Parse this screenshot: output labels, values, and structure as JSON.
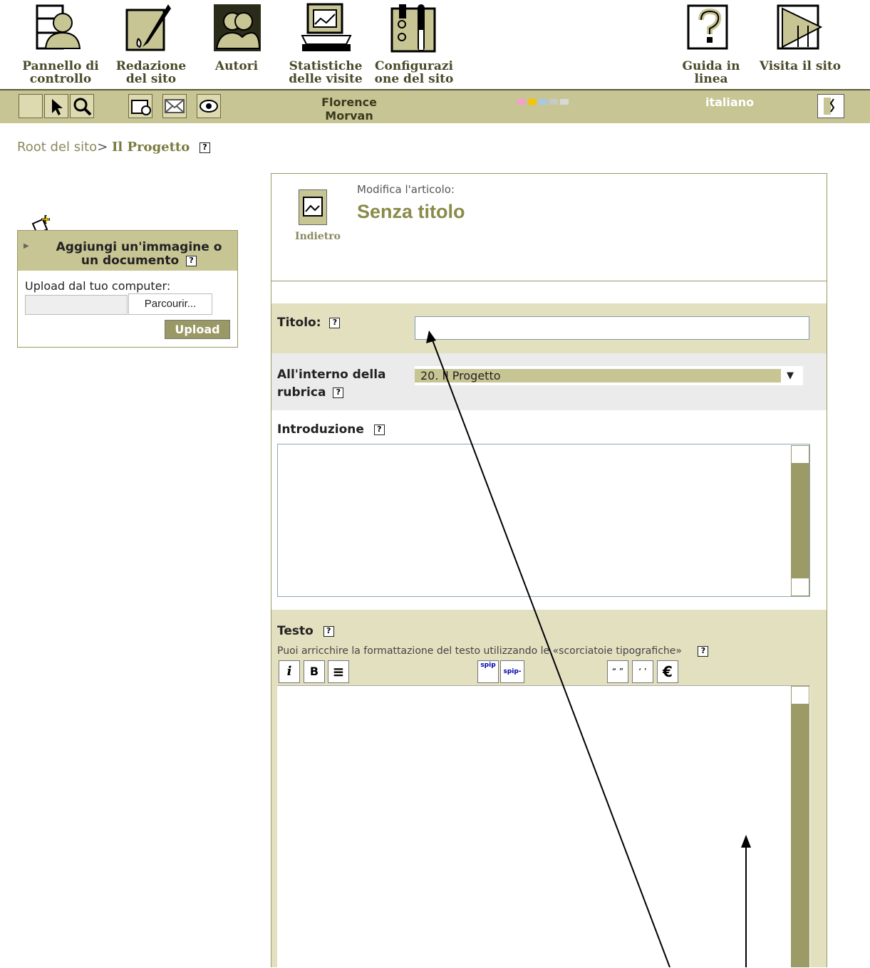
{
  "nav": {
    "items": [
      {
        "label": "Pannello di controllo",
        "icon": "dashboard-icon"
      },
      {
        "label": "Redazione del sito",
        "icon": "pen-icon"
      },
      {
        "label": "Autori",
        "icon": "authors-icon"
      },
      {
        "label": "Statistiche delle visite",
        "icon": "statistics-icon"
      },
      {
        "label": "Configurazi one del sito",
        "icon": "configuration-icon"
      },
      {
        "label": "Guida in linea",
        "icon": "help-icon"
      },
      {
        "label": "Visita il sito",
        "icon": "visit-site-icon"
      }
    ]
  },
  "toolbar": {
    "user_name": "Florence Morvan",
    "language": "italiano",
    "color_swatches": [
      "#f4a0c8",
      "#f6c400",
      "#a8c8e8",
      "#c8c8c8",
      "#d8d8d8"
    ]
  },
  "breadcrumb": {
    "root": "Root del sito",
    "separator": ">",
    "current": "Il Progetto"
  },
  "upload_box": {
    "title": "Aggiungi un'immagine o un documento",
    "prompt": "Upload dal tuo computer:",
    "browse_label": "Parcourir...",
    "upload_label": "Upload"
  },
  "article": {
    "heading_label": "Modifica l'articolo:",
    "title": "Senza titolo",
    "back_label": "Indietro"
  },
  "form": {
    "title_label": "Titolo:",
    "title_value": "",
    "rubric_label": "All'interno della rubrica",
    "rubric_value": "20. Il Progetto",
    "intro_label": "Introduzione",
    "text_label": "Testo",
    "text_hint": "Puoi arricchire la formattazione del testo utilizzando le «scorciatoie tipografiche»",
    "format_buttons": [
      "i",
      "B",
      "≡",
      "spip",
      "spip-note",
      "“ ”",
      "‘ ’",
      "€"
    ]
  },
  "help_mark": "?",
  "colors": {
    "olive": "#9a9966",
    "khaki": "#c8c594",
    "title_green": "#8a8a4a"
  }
}
